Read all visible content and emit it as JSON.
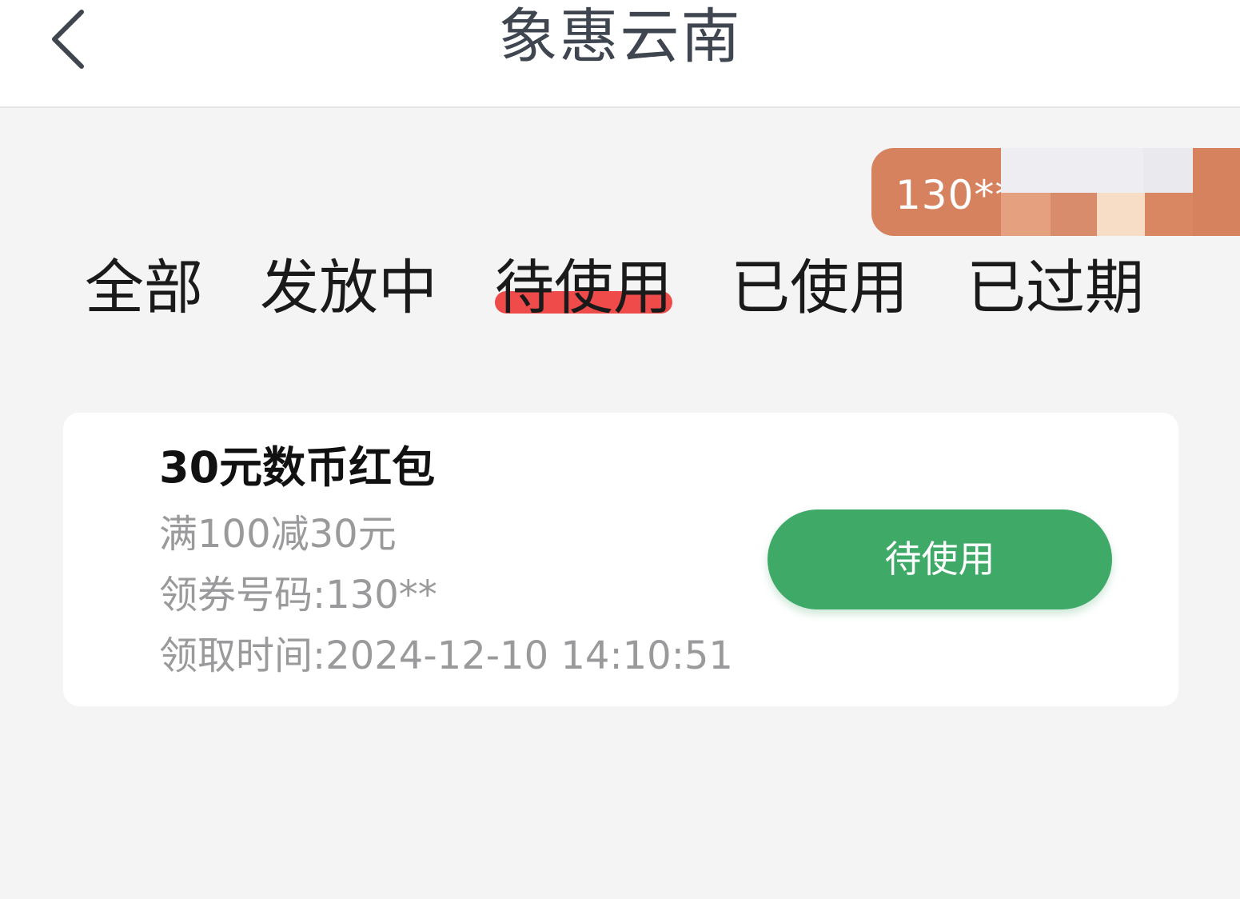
{
  "header": {
    "title": "象惠云南",
    "back_icon": "chevron-left-icon"
  },
  "phone_badge": {
    "text": "130**"
  },
  "tabs": [
    {
      "label": "全部",
      "active": false
    },
    {
      "label": "发放中",
      "active": false
    },
    {
      "label": "待使用",
      "active": true
    },
    {
      "label": "已使用",
      "active": false
    },
    {
      "label": "已过期",
      "active": false
    }
  ],
  "coupons": [
    {
      "title": "30元数币红包",
      "rule": "满100减30元",
      "code": "领券号码:130**",
      "time": "领取时间:2024-12-10 14:10:51",
      "button_label": "待使用"
    }
  ],
  "colors": {
    "header_bg": "#ffffff",
    "page_bg": "#f4f4f5",
    "title_text": "#3f4650",
    "badge_bg": "#d6825f",
    "active_tab_underline": "#ef4b4b",
    "button_bg": "#3fa967",
    "secondary_text": "#9a9a9c"
  }
}
